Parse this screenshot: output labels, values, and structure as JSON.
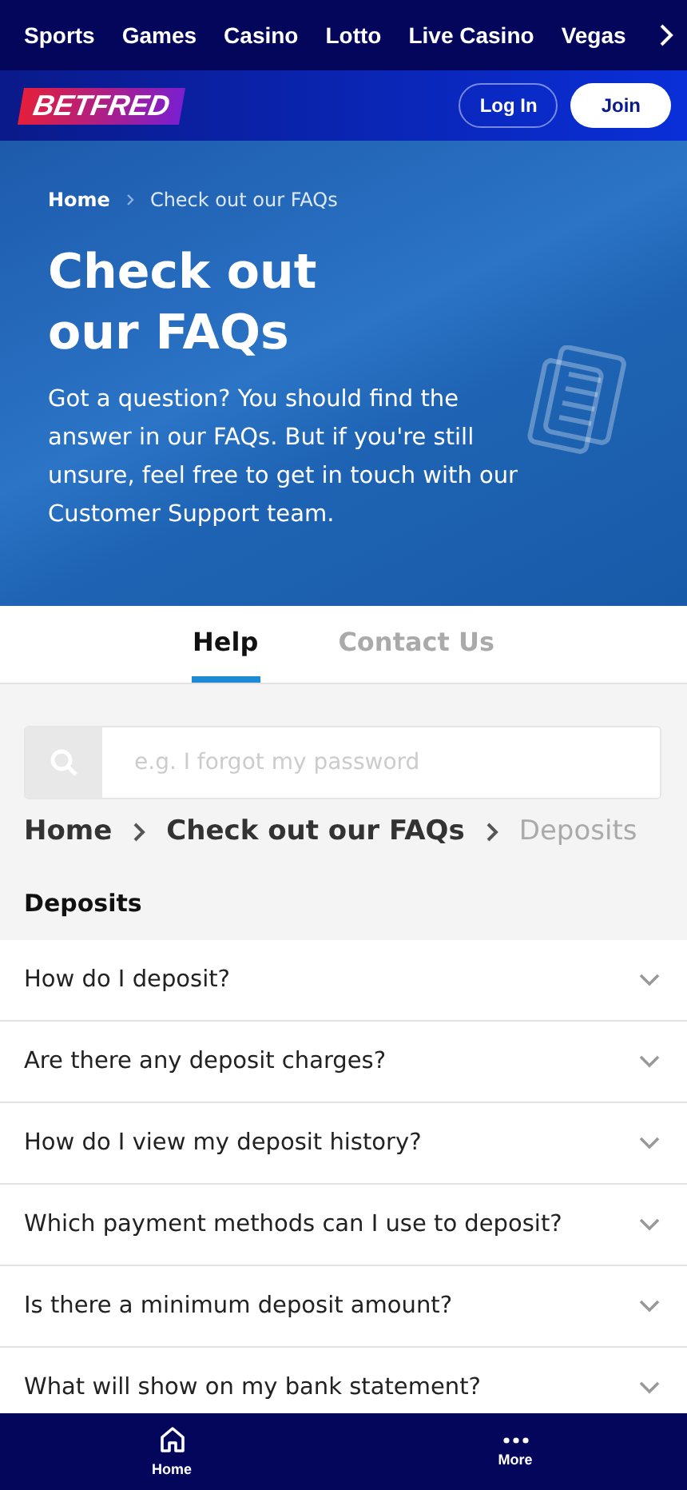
{
  "top_nav": [
    {
      "label": "Sports"
    },
    {
      "label": "Games"
    },
    {
      "label": "Casino"
    },
    {
      "label": "Lotto"
    },
    {
      "label": "Live Casino"
    },
    {
      "label": "Vegas"
    }
  ],
  "header": {
    "logo": "BETFRED",
    "login": "Log In",
    "join": "Join"
  },
  "hero": {
    "breadcrumbs": [
      "Home",
      "Check out our FAQs"
    ],
    "title_lines": [
      "Check out",
      "our FAQs"
    ],
    "text": "Got a question? You should find the answer in our FAQs. But if you're still unsure, feel free to get in touch with our Customer Support team."
  },
  "tabs": [
    {
      "label": "Help",
      "selected": true
    },
    {
      "label": "Contact Us",
      "selected": false
    }
  ],
  "search": {
    "placeholder": "e.g. I forgot my password"
  },
  "breadcrumbs": [
    "Home",
    "Check out our FAQs",
    "Deposits"
  ],
  "section_title": "Deposits",
  "faqs": [
    {
      "question": "How do I deposit?",
      "expanded": false
    },
    {
      "question": "Are there any deposit charges?",
      "expanded": false
    },
    {
      "question": "How do I view my deposit history?",
      "expanded": false
    },
    {
      "question": "Which payment methods can I use to deposit?",
      "expanded": false
    },
    {
      "question": "Is there a minimum deposit amount?",
      "expanded": false
    },
    {
      "question": "What will show on my bank statement?",
      "expanded": false
    }
  ],
  "bottom_nav": [
    {
      "kind": "home",
      "label": "Home"
    },
    {
      "kind": "more",
      "label": "More"
    }
  ]
}
